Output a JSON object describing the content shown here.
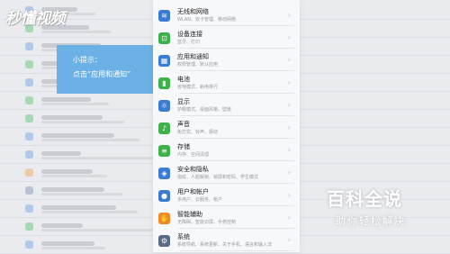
{
  "watermark": {
    "logo_text": "秒懂视频"
  },
  "tip": {
    "title": "小提示：",
    "text": "点击“应用和通知”"
  },
  "settings": {
    "items": [
      {
        "label": "无线和网络",
        "sub": "WLAN、双卡管理、移动网络",
        "icon": "wifi-icon",
        "color": "#3a7bd5"
      },
      {
        "label": "设备连接",
        "sub": "蓝牙、打印",
        "icon": "device-link-icon",
        "color": "#3db24b"
      },
      {
        "label": "应用和通知",
        "sub": "权限管理、默认应用",
        "icon": "apps-icon",
        "color": "#3a7bd5"
      },
      {
        "label": "电池",
        "sub": "省电模式、耗电排行",
        "icon": "battery-icon",
        "color": "#3db24b"
      },
      {
        "label": "显示",
        "sub": "护眼模式、桌面风格、壁纸",
        "icon": "display-icon",
        "color": "#3a7bd5"
      },
      {
        "label": "声音",
        "sub": "免打扰、铃声、振动",
        "icon": "sound-icon",
        "color": "#3db24b"
      },
      {
        "label": "存储",
        "sub": "内存、空间清理",
        "icon": "storage-icon",
        "color": "#3db24b"
      },
      {
        "label": "安全和隐私",
        "sub": "指纹、人脸解锁、锁屏和密码、学生模式",
        "icon": "security-icon",
        "color": "#3a7bd5"
      },
      {
        "label": "用户和帐户",
        "sub": "多用户、云服务、帐户",
        "icon": "user-icon",
        "color": "#3a7bd5"
      },
      {
        "label": "智能辅助",
        "sub": "无障碍、智能识屏、手势控制",
        "icon": "assist-icon",
        "color": "#f08a24"
      },
      {
        "label": "系统",
        "sub": "系统导航、系统更新、关于手机、语言和输入法",
        "icon": "system-icon",
        "color": "#5a6b86"
      }
    ]
  },
  "brand": {
    "title": "百科全说",
    "subtitle": "助你轻松解决"
  }
}
